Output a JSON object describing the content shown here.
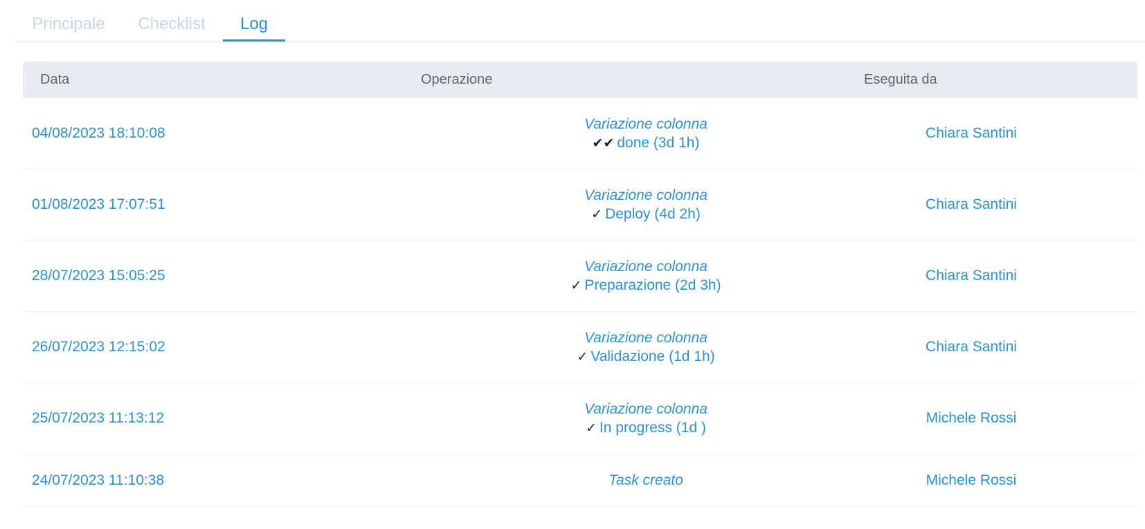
{
  "tabs": [
    {
      "label": "Principale",
      "active": false
    },
    {
      "label": "Checklist",
      "active": false
    },
    {
      "label": "Log",
      "active": true
    }
  ],
  "table": {
    "headers": {
      "date": "Data",
      "operation": "Operazione",
      "executed_by": "Eseguita da"
    },
    "rows": [
      {
        "date": "04/08/2023 18:10:08",
        "op_title": "Variazione colonna",
        "check_icon": "double-check-icon",
        "check_glyph": "✔✔",
        "op_detail": "done (3d 1h)",
        "executed_by": "Chiara Santini"
      },
      {
        "date": "01/08/2023 17:07:51",
        "op_title": "Variazione colonna",
        "check_icon": "check-icon",
        "check_glyph": "✓",
        "op_detail": "Deploy (4d 2h)",
        "executed_by": "Chiara Santini"
      },
      {
        "date": "28/07/2023 15:05:25",
        "op_title": "Variazione colonna",
        "check_icon": "check-icon",
        "check_glyph": "✓",
        "op_detail": "Preparazione (2d 3h)",
        "executed_by": "Chiara Santini"
      },
      {
        "date": "26/07/2023 12:15:02",
        "op_title": "Variazione colonna",
        "check_icon": "check-icon",
        "check_glyph": "✓",
        "op_detail": "Validazione (1d 1h)",
        "executed_by": "Chiara Santini"
      },
      {
        "date": "25/07/2023 11:13:12",
        "op_title": "Variazione colonna",
        "check_icon": "check-icon",
        "check_glyph": "✓",
        "op_detail": "In progress (1d )",
        "executed_by": "Michele Rossi"
      },
      {
        "date": "24/07/2023 11:10:38",
        "op_title": "Task creato",
        "executed_by": "Michele Rossi"
      }
    ]
  },
  "colors": {
    "accent": "#2f8fd4",
    "tab_inactive": "#c9d6e3",
    "header_bg": "#e8ebef"
  }
}
